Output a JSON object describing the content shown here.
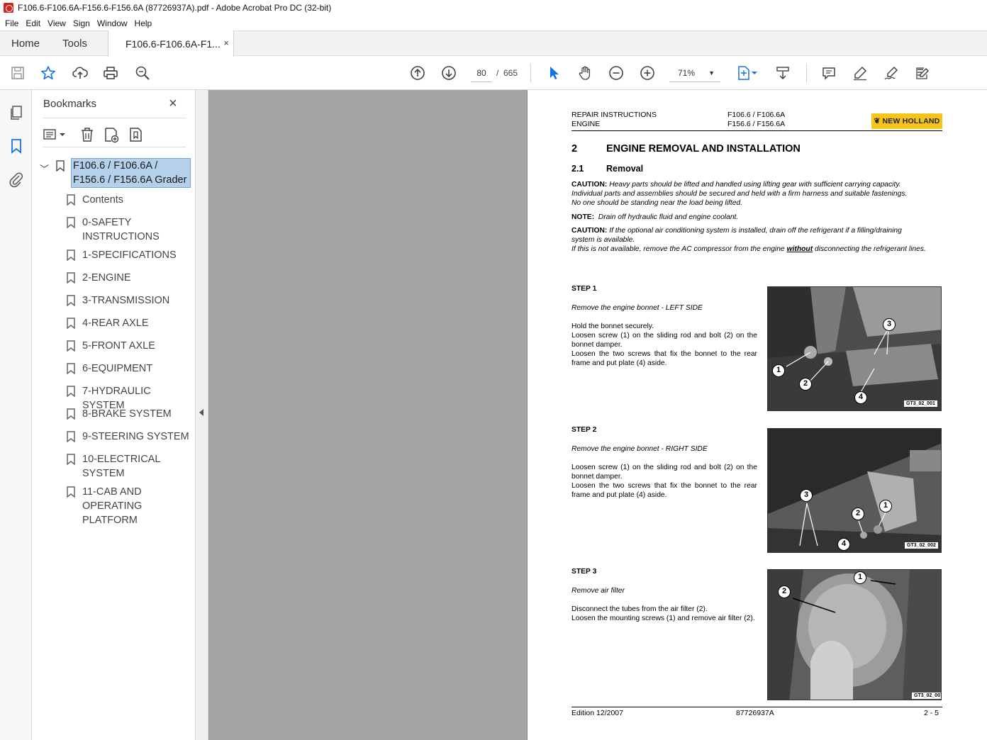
{
  "window": {
    "title": "F106.6-F106.6A-F156.6-F156.6A (87726937A).pdf - Adobe Acrobat Pro DC (32-bit)"
  },
  "menu": [
    "File",
    "Edit",
    "View",
    "Sign",
    "Window",
    "Help"
  ],
  "tabs": {
    "home": "Home",
    "tools": "Tools",
    "document": "F106.6-F106.6A-F1...",
    "close": "×"
  },
  "toolbar": {
    "page_current": "80",
    "page_separator": "/",
    "page_total": "665",
    "zoom": "71%"
  },
  "bookmarks": {
    "header": "Bookmarks",
    "close": "×",
    "root": "F106.6 / F106.6A / F156.6 / F156.6A Grader",
    "items": [
      "Contents",
      "0-SAFETY INSTRUCTIONS",
      "1-SPECIFICATIONS",
      "2-ENGINE",
      "3-TRANSMISSION",
      "4-REAR AXLE",
      "5-FRONT AXLE",
      "6-EQUIPMENT",
      "7-HYDRAULIC SYSTEM",
      "8-BRAKE SYSTEM",
      "9-STEERING SYSTEM",
      "10-ELECTRICAL SYSTEM",
      "11-CAB AND OPERATING PLATFORM"
    ]
  },
  "doc": {
    "header_left_1": "REPAIR INSTRUCTIONS",
    "header_left_2": "ENGINE",
    "header_mid_1": "F106.6 / F106.6A",
    "header_mid_2": "F156.6 / F156.6A",
    "logo": "NEW HOLLAND",
    "section_num": "2",
    "section_title": "ENGINE REMOVAL AND INSTALLATION",
    "sub_num": "2.1",
    "sub_title": "Removal",
    "caution1_label": "CAUTION:",
    "caution1_l1": "Heavy parts should be lifted and handled using lifting gear with sufficient carrying capacity.",
    "caution1_l2": "Individual parts and assemblies should be secured and held with a firm harness and suitable fastenings.",
    "caution1_l3": "No one should be standing near the load being lifted.",
    "note_label": "NOTE:",
    "note_text": "Drain off hydraulic fluid and engine coolant.",
    "caution2_label": "CAUTION:",
    "caution2_l1": "If the optional air conditioning system is installed, drain off the refrigerant if a filling/draining",
    "caution2_l2": "system is available.",
    "caution2_l3a": "If this is not available, remove the AC compressor from the engine",
    "caution2_l3b": "without",
    "caution2_l3c": "disconnecting the refrigerant lines.",
    "step1_label": "STEP 1",
    "step1_title": "Remove the engine bonnet - LEFT SIDE",
    "step1_l1": "Hold the bonnet securely.",
    "step1_l2": "Loosen screw (1) on the sliding rod and bolt (2) on the bonnet damper.",
    "step1_l3": "Loosen the two screws that fix the bonnet to the rear frame and put plate (4) aside.",
    "step1_code": "GT3_02_001",
    "step2_label": "STEP 2",
    "step2_title": "Remove the engine bonnet - RIGHT SIDE",
    "step2_l1": "Loosen screw (1) on the sliding rod and bolt (2) on the bonnet damper.",
    "step2_l2": "Loosen the two screws that fix the bonnet to the rear frame and put plate (4) aside.",
    "step2_code": "GT3_02_002",
    "step3_label": "STEP 3",
    "step3_title": "Remove air filter",
    "step3_l1": "Disconnect the tubes from the air filter (2).",
    "step3_l2": "Loosen the mounting screws (1) and remove air filter (2).",
    "step3_code": "GT3_02_007",
    "callouts": [
      "1",
      "2",
      "3",
      "4"
    ],
    "footer_left": "Edition 12/2007",
    "footer_mid": "87726937A",
    "footer_right": "2 - 5"
  },
  "colors": {
    "accent_blue": "#1473e6",
    "selection": "#b4d0ea",
    "logo_yellow": "#f5c51c",
    "canvas_gray": "#a4a4a4"
  }
}
